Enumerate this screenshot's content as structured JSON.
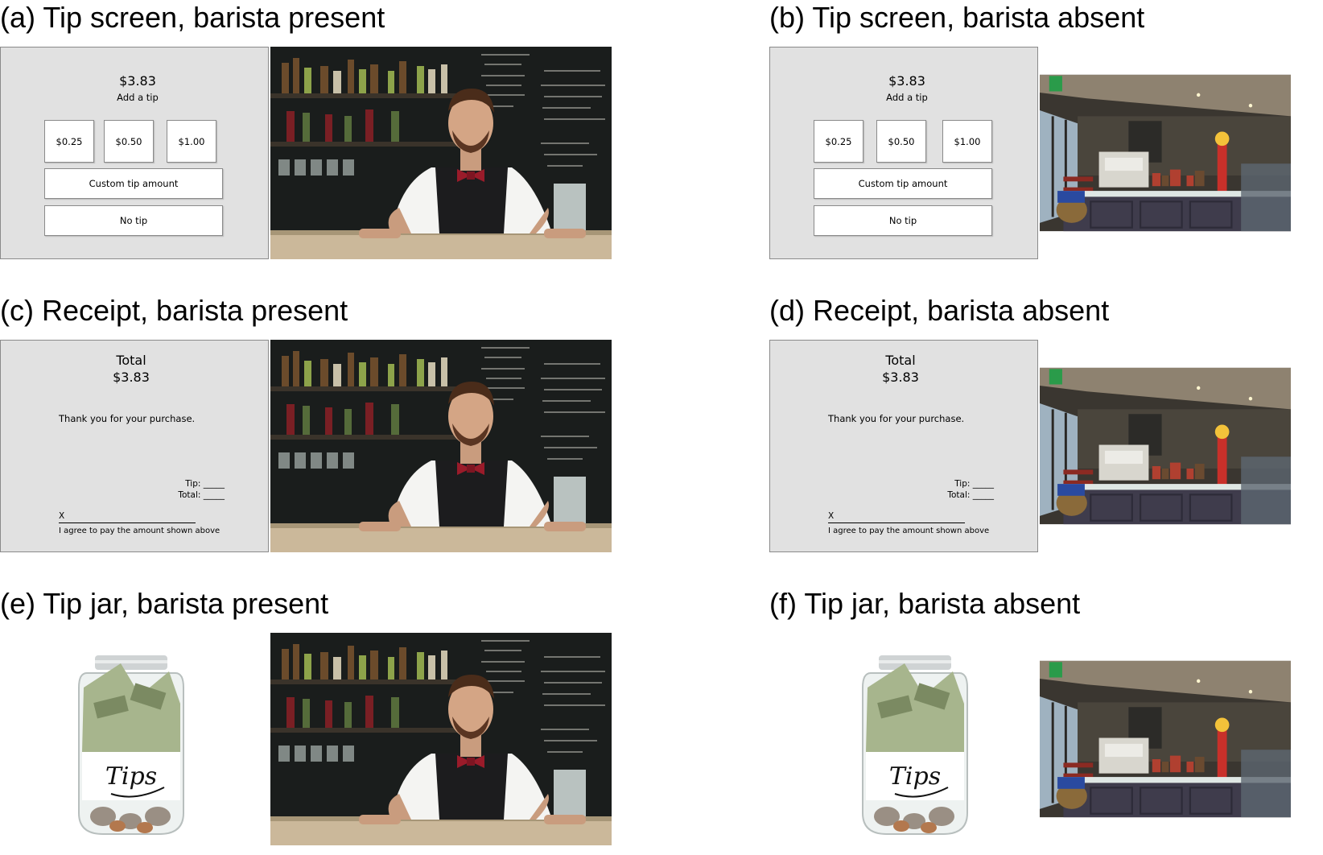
{
  "panels": {
    "a": {
      "caption": "(a) Tip screen, barista present"
    },
    "b": {
      "caption": "(b) Tip screen, barista absent"
    },
    "c": {
      "caption": "(c) Receipt, barista present"
    },
    "d": {
      "caption": "(d) Receipt, barista absent"
    },
    "e": {
      "caption": "(e) Tip jar, barista present"
    },
    "f": {
      "caption": "(f) Tip jar, barista absent"
    }
  },
  "tip_screen": {
    "amount": "$3.83",
    "subtitle": "Add a tip",
    "options": [
      "$0.25",
      "$0.50",
      "$1.00"
    ],
    "custom_label": "Custom tip amount",
    "no_tip_label": "No tip"
  },
  "receipt": {
    "total_label": "Total",
    "total_amount": "$3.83",
    "thanks": "Thank you for your purchase.",
    "tip_line": "Tip: _____",
    "total_line": "Total: _____",
    "sign_x": "X",
    "agree": "I agree to pay the amount shown above"
  },
  "jar_label": "Tips",
  "colors": {
    "screen_bg": "#e1e1e1",
    "bowtie": "#9a1b2a",
    "apron": "#1c1c1e",
    "shirt": "#f4f4f2",
    "bar_back": "#1a1d1c",
    "counter": "#cbb89a",
    "cafe_cabinet": "#3f3c4c"
  },
  "icons": {
    "barista_photo": "barista-photo",
    "cafe_photo": "cafe-photo",
    "tip_jar": "tip-jar"
  }
}
